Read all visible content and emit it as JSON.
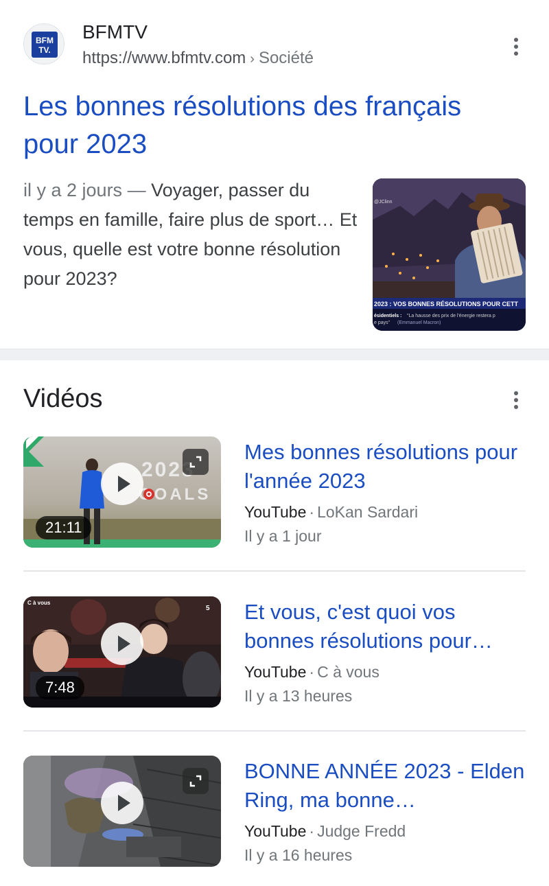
{
  "result": {
    "site_name": "BFMTV",
    "url": "https://www.bfmtv.com",
    "breadcrumb": "Société",
    "title": "Les bonnes résolutions des français pour 2023",
    "date": "il y a 2 jours",
    "dash": " — ",
    "snippet": "Voyager, passer du temps en famille, faire plus de sport… Et vous, quelle est votre bonne résolution pour 2023?",
    "logo_text_top": "BFM",
    "logo_text_bottom": "TV.",
    "thumbnail": {
      "caption": "2023 : VOS BONNES RÉSOLUTIONS POUR CETT",
      "subcaption_label": "ésidentiels :",
      "subcaption_quote": "\"La hausse des prix de l'énergie restera p",
      "subcaption_line2": "e pays\"",
      "subcaption_author": "(Emmanuel Macron)",
      "handle": "@JClinn"
    }
  },
  "videos_section": {
    "heading": "Vidéos",
    "items": [
      {
        "title": "Mes bonnes résolutions pour l'année 2023",
        "source": "YouTube",
        "channel": "LoKan Sardari",
        "age": "Il y a 1 jour",
        "duration": "21:11",
        "thumb_text": "2023 GOALS",
        "has_expand": true
      },
      {
        "title": "Et vous, c'est quoi vos bonnes résolutions pour…",
        "source": "YouTube",
        "channel": "C à vous",
        "age": "Il y a 13 heures",
        "duration": "7:48",
        "has_expand": false
      },
      {
        "title": "BONNE ANNÉE 2023 - Elden Ring, ma bonne…",
        "source": "YouTube",
        "channel": "Judge Fredd",
        "age": "Il y a 16 heures",
        "duration": "",
        "has_expand": true
      }
    ]
  },
  "colors": {
    "link": "#1a4dc2",
    "secondary_text": "#70757a",
    "divider": "#e3e5e8"
  }
}
